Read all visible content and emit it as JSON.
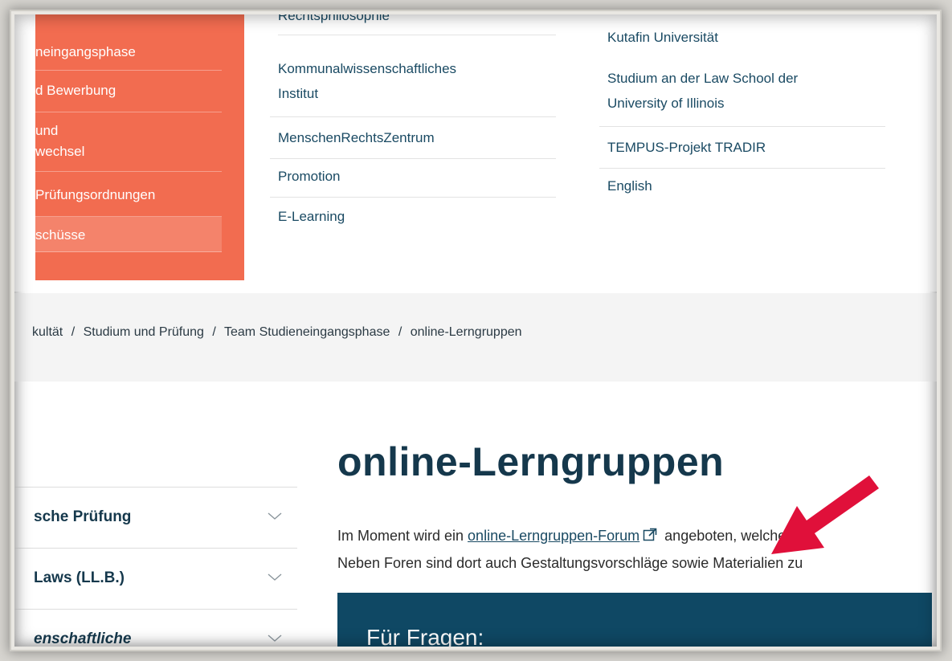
{
  "coral_menu": {
    "items": [
      {
        "label": "neingangsphase",
        "active": false
      },
      {
        "label": "d Bewerbung",
        "active": false
      },
      {
        "label": "und",
        "label2": "wechsel",
        "active": false
      },
      {
        "label": "Prüfungsordnungen",
        "active": false
      },
      {
        "label": "schüsse",
        "active": true
      }
    ]
  },
  "menu_col2": {
    "cut_item": "Rechtsphilosophie",
    "items": [
      {
        "label": "Kommunalwissenschaftliches",
        "label2": "Institut"
      },
      {
        "label": "MenschenRechtsZentrum"
      },
      {
        "label": "Promotion"
      },
      {
        "label": "E-Learning"
      }
    ]
  },
  "menu_col3": {
    "items": [
      {
        "label": "Kutafin Universität"
      },
      {
        "label": "Studium an der Law School der",
        "label2": "University of Illinois"
      },
      {
        "label": "TEMPUS-Projekt TRADIR"
      },
      {
        "label": "English"
      }
    ]
  },
  "breadcrumb": {
    "items": [
      "kultät",
      "Studium und Prüfung",
      "Team Studieneingangsphase",
      "online-Lerngruppen"
    ],
    "separator": "/"
  },
  "sidebar": {
    "items": [
      {
        "label": "sche Prüfung"
      },
      {
        "label": "Laws (LL.B.)"
      },
      {
        "label": "enschaftliche"
      }
    ]
  },
  "main": {
    "title": "online-Lerngruppen",
    "para_line1_pre": "Im Moment wird ein ",
    "para_link": "online-Lerngruppen-Forum",
    "para_line1_post": " angeboten, welches",
    "para_line2": "Neben Foren sind dort auch Gestaltungsvorschläge sowie Materialien zu",
    "box_title": "Für Fragen:"
  },
  "colors": {
    "coral": "#f26c50",
    "navy": "#15384c",
    "box": "#0f4864",
    "arrow": "#e0103a"
  }
}
